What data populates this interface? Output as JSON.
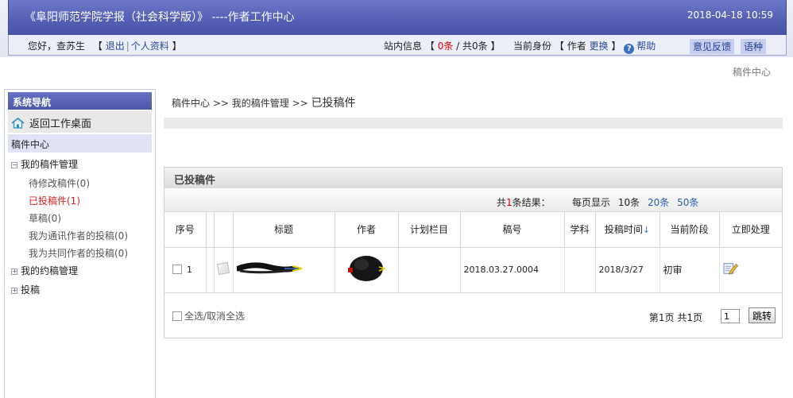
{
  "header": {
    "title": "《阜阳师范学院学报（社会科学版）》 ----作者工作中心",
    "datetime": "2018-04-18 10:59",
    "greeting": "您好，查苏生",
    "logout": "退出",
    "profile": "个人资料",
    "site_info_label": "站内信息",
    "unread": "0条",
    "total": "共0条",
    "identity_label": "当前身份",
    "identity_value": "作者",
    "switch": "更换",
    "help": "帮助",
    "feedback": "意见反馈",
    "language": "语种"
  },
  "top_breadcrumb": "稿件中心",
  "sidebar": {
    "heading": "系统导航",
    "home": "返回工作桌面",
    "center": "稿件中心",
    "my_manuscripts": "我的稿件管理",
    "items": [
      {
        "label": "待修改稿件(0)"
      },
      {
        "label": "已投稿件(1)"
      },
      {
        "label": "草稿(0)"
      },
      {
        "label": "我为通讯作者的投稿(0)"
      },
      {
        "label": "我为共同作者的投稿(0)"
      }
    ],
    "my_invited": "我的约稿管理",
    "submit": "投稿"
  },
  "breadcrumb": {
    "part1": "稿件中心",
    "sep": ">>",
    "part2": "我的稿件管理",
    "current": "已投稿件"
  },
  "panel": {
    "title": "已投稿件",
    "results_prefix": "共",
    "results_count": "1",
    "results_suffix": "条结果：",
    "per_page_label": "每页显示",
    "opt10": "10条",
    "opt20": "20条",
    "opt50": "50条",
    "columns": [
      "序号",
      "标题",
      "作者",
      "计划栏目",
      "稿号",
      "学科",
      "投稿时间",
      "当前阶段",
      "立即处理"
    ],
    "rows": [
      {
        "index": "1",
        "plan": "",
        "number": "2018.03.27.0004",
        "subject": "",
        "date": "2018/3/27",
        "stage": "初审"
      }
    ],
    "select_all": "全选/取消全选",
    "pager": "第1页 共1页",
    "page_value": "1",
    "jump": "跳转"
  },
  "colors": {
    "title_bar": "#5560b5",
    "link": "#2a4aa0",
    "active": "#d22222"
  }
}
